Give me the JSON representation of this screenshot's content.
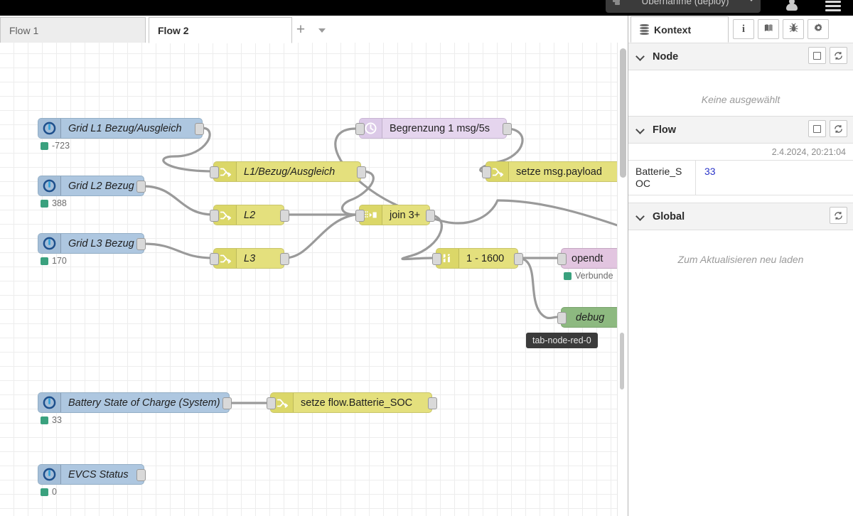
{
  "header": {
    "deploy_label": "Übernahme (deploy)",
    "deploy_icon": "deploy-icon",
    "user_icon": "user-icon",
    "menu_icon": "hamburger-menu-icon",
    "caret_icon": "chevron-down-icon"
  },
  "tabs": {
    "items": [
      {
        "label": "Flow 1",
        "active": false
      },
      {
        "label": "Flow 2",
        "active": true
      }
    ],
    "add_label": "+",
    "add_icon": "plus-icon",
    "list_icon": "chevron-down-icon"
  },
  "canvas": {
    "tooltip": "tab-node-red-0",
    "nodes": [
      {
        "id": "grid-l1",
        "label": "Grid L1 Bezug/Ausgleich",
        "status": "-723",
        "icon": "power-info-icon"
      },
      {
        "id": "grid-l2",
        "label": "Grid L2 Bezug",
        "status": "388",
        "icon": "power-info-icon"
      },
      {
        "id": "grid-l3",
        "label": "Grid L3 Bezug",
        "status": "170",
        "icon": "power-info-icon"
      },
      {
        "id": "chg-l1",
        "label": "L1/Bezug/Ausgleich",
        "status": "",
        "icon": "change-node-icon"
      },
      {
        "id": "chg-l2",
        "label": "L2",
        "status": "",
        "icon": "change-node-icon"
      },
      {
        "id": "chg-l3",
        "label": "L3",
        "status": "",
        "icon": "change-node-icon"
      },
      {
        "id": "join",
        "label": "join 3+",
        "status": "",
        "icon": "join-node-icon"
      },
      {
        "id": "delay",
        "label": "Begrenzung 1 msg/5s",
        "status": "",
        "icon": "clock-icon"
      },
      {
        "id": "setpay",
        "label": "setze msg.payload",
        "status": "",
        "icon": "change-node-icon"
      },
      {
        "id": "range",
        "label": "1 - 1600",
        "status": "",
        "icon": "range-node-icon"
      },
      {
        "id": "opendtu",
        "label": "opendt",
        "status": "Verbunde",
        "icon": "mqtt-node-icon"
      },
      {
        "id": "debug",
        "label": "debug",
        "status": "",
        "icon": "debug-node-icon"
      },
      {
        "id": "battery",
        "label": "Battery State of Charge (System)",
        "status": "33",
        "icon": "power-info-icon"
      },
      {
        "id": "setsoc",
        "label": "setze flow.Batterie_SOC",
        "status": "",
        "icon": "change-node-icon"
      },
      {
        "id": "evcs",
        "label": "EVCS Status",
        "status": "0",
        "icon": "power-info-icon"
      }
    ]
  },
  "sidebar": {
    "tab_label": "Kontext",
    "tab_icon": "context-stack-icon",
    "toolbar": [
      {
        "name": "info-icon",
        "glyph": "i"
      },
      {
        "name": "help-book-icon",
        "glyph": "▤"
      },
      {
        "name": "debug-bug-icon",
        "glyph": "※"
      },
      {
        "name": "gear-icon",
        "glyph": "✿"
      }
    ],
    "toolbar_more_icon": "chevron-down-icon",
    "sections": [
      {
        "id": "node",
        "title": "Node",
        "empty_message": "Keine ausgewählt",
        "buttons": [
          "select-scope-button",
          "refresh-button"
        ]
      },
      {
        "id": "flow",
        "title": "Flow",
        "timestamp": "2.4.2024, 20:21:04",
        "buttons": [
          "select-scope-button",
          "refresh-button"
        ],
        "entries": [
          {
            "key": "Batterie_SOC",
            "value": "33"
          }
        ]
      },
      {
        "id": "global",
        "title": "Global",
        "empty_message": "Zum Aktualisieren neu laden",
        "buttons": [
          "refresh-button"
        ]
      }
    ]
  },
  "colors": {
    "node_blue": "#aec7e0",
    "node_yellow": "#e4e07d",
    "node_purple": "#e5d5ee",
    "node_pink": "#e2c5e0",
    "node_green": "#8db980",
    "status_green": "#3aa17e",
    "value_blue": "#2a34c8",
    "wire": "#9a9a9a"
  }
}
